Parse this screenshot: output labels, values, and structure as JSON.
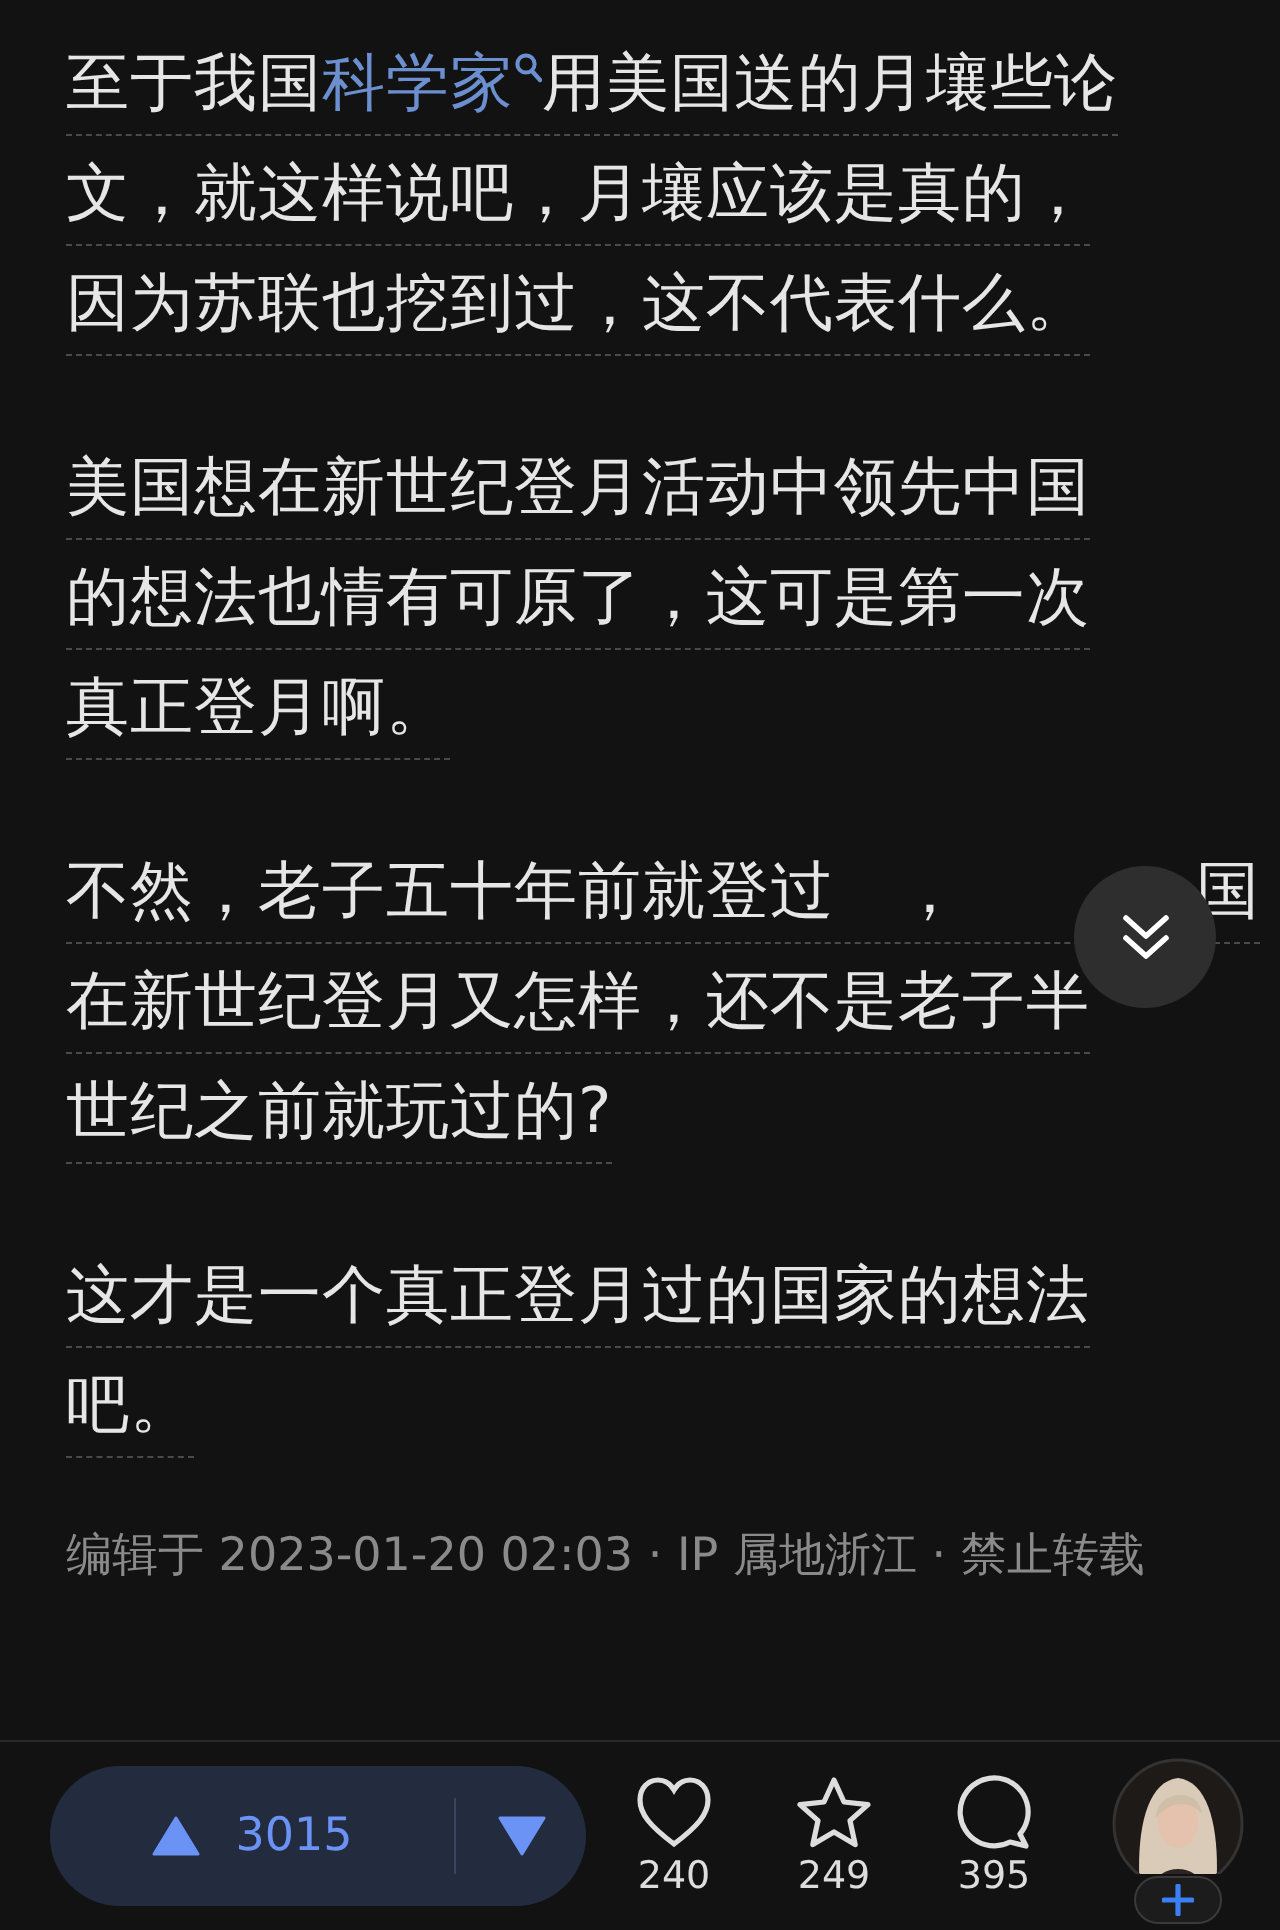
{
  "paragraphs": [
    {
      "lines": [
        [
          {
            "kind": "text",
            "text": "至于我国"
          },
          {
            "kind": "link",
            "text": "科学家"
          },
          {
            "kind": "text",
            "text": "用美国送的月壤些论"
          }
        ],
        [
          {
            "kind": "text",
            "text": "文，就这样说吧，月壤应该是真的，"
          }
        ],
        [
          {
            "kind": "text",
            "text": "因为苏联也挖到过，这不代表什么。"
          }
        ]
      ]
    },
    {
      "lines": [
        [
          {
            "kind": "text",
            "text": "美国想在新世纪登月活动中领先中国"
          }
        ],
        [
          {
            "kind": "text",
            "text": "的想法也情有可原了，这可是第一次"
          }
        ],
        [
          {
            "kind": "text",
            "text": "真正登月啊。"
          }
        ]
      ]
    },
    {
      "lines": [
        [
          {
            "kind": "text",
            "text": "不然，老子五十年前就登过　，"
          },
          {
            "kind": "text_end",
            "text": "国"
          }
        ],
        [
          {
            "kind": "text",
            "text": "在新世纪登月又怎样，还不是老子半"
          }
        ],
        [
          {
            "kind": "text",
            "text": "世纪之前就玩过的?"
          }
        ]
      ]
    },
    {
      "lines": [
        [
          {
            "kind": "text",
            "text": "这才是一个真正登月过的国家的想法"
          }
        ],
        [
          {
            "kind": "text",
            "text": "吧。"
          }
        ]
      ]
    }
  ],
  "meta": "编辑于 2023-01-20 02:03 · IP 属地浙江 · 禁止转载",
  "vote": {
    "count": "3015"
  },
  "actions": [
    {
      "kind": "like",
      "count": "240"
    },
    {
      "kind": "favorite",
      "count": "249"
    },
    {
      "kind": "comment",
      "count": "395"
    }
  ]
}
